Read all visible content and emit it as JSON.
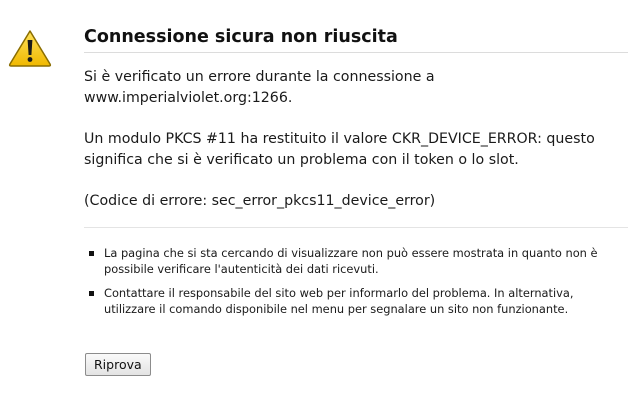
{
  "error": {
    "icon": "warning-icon",
    "title": "Connessione sicura non riuscita",
    "short_desc": {
      "line1": "Si è verificato un errore durante la connessione a",
      "line2": "www.imperialviolet.org:1266.",
      "para2": "Un modulo PKCS #11 ha restituito il valore CKR_DEVICE_ERROR: questo significa che si è verificato un problema con il token o lo slot.",
      "code": "(Codice di errore: sec_error_pkcs11_device_error)"
    },
    "long_desc": [
      "La pagina che si sta cercando di visualizzare non può essere mostrata in quanto non è possibile verificare l'autenticità dei dati ricevuti.",
      "Contattare il responsabile del sito web per informarlo del problema. In alternativa, utilizzare il comando disponibile nel menu per segnalare un sito non funzionante."
    ],
    "retry_label": "Riprova"
  },
  "colors": {
    "icon_fill": "#f2c200",
    "icon_outline": "#8a6d00",
    "text": "#111111",
    "rule": "#dcdcdc"
  }
}
